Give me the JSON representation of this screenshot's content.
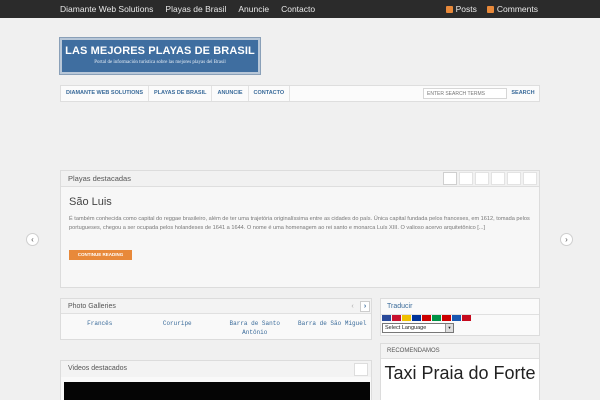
{
  "topbar": {
    "nav": [
      "Diamante Web Solutions",
      "Playas de Brasil",
      "Anuncie",
      "Contacto"
    ],
    "feeds": {
      "posts": "Posts",
      "comments": "Comments",
      "accent": "#e8893a"
    }
  },
  "logo": {
    "title": "LAS MEJORES PLAYAS DE BRASIL",
    "subtitle": "Portal de información turística sobre las mejores playas del Brasil"
  },
  "mainnav": {
    "items": [
      "DIAMANTE WEB SOLUTIONS",
      "PLAYAS DE BRASIL",
      "ANUNCIE",
      "CONTACTO"
    ],
    "search_placeholder": "ENTER SEARCH TERMS",
    "search_button": "SEARCH"
  },
  "featured": {
    "title": "Playas destacadas",
    "post_title": "São Luis",
    "excerpt": "É também conhecida como capital do reggae brasileiro, além de ter uma trajetória originalíssima entre as cidades do país. Única capital fundada pelos franceses, em 1612, tomada pelos portugueses, chegou a ser ocupada pelos holandeses de 1641 a 1644. O nome é uma homenagem ao rei santo e monarca Luís XIII. O valioso acervo arquitetônico [...]",
    "read_more": "CONTINUE READING",
    "accent": "#e8893a"
  },
  "arrows": {
    "prev": "‹",
    "next": "›"
  },
  "gallery": {
    "title": "Photo Galleries",
    "prev": "‹",
    "next": "›",
    "items": [
      "Francês",
      "Coruripe",
      "Barra de Santo Antônio",
      "Barra de São Miguel"
    ]
  },
  "videos": {
    "title": "Videos destacados"
  },
  "translate": {
    "title": "Traducir",
    "select_value": "Select Language",
    "flags": [
      "#2a4a9a",
      "#c8102e",
      "#f0c000",
      "#003399",
      "#cc0000",
      "#009246",
      "#cc0000",
      "#1a57b0",
      "#c60b1e"
    ]
  },
  "recommend": {
    "title": "RECOMENDAMOS",
    "ad_text": "Taxi Praia do Forte"
  },
  "colors": {
    "link": "#3a6b9a",
    "logo_bg": "#3f6ea0",
    "topbar": "#2b2b2b"
  }
}
